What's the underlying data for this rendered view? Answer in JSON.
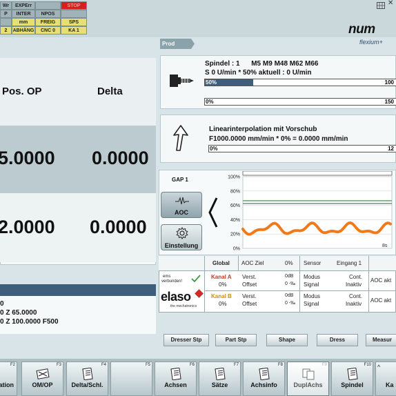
{
  "status_grid": {
    "r1": [
      "Wr",
      "EXPErr",
      "",
      "STOP"
    ],
    "r2": [
      "P",
      "INTER",
      "NPOS",
      ""
    ],
    "r3": [
      "",
      "mm",
      "FREIG",
      "SPS"
    ],
    "r4": [
      "2",
      "ABHÄNG",
      "CNC 0",
      "KA 1"
    ]
  },
  "brand": {
    "logo": "num",
    "subtitle": "flexium+",
    "window_icon": "window-grid-icon",
    "close_glyph": "✕"
  },
  "mode_tab": "Prod",
  "axis_table": {
    "col_pos": "Pos. OP",
    "col_delta": "Delta",
    "rows": [
      {
        "pos": "5.0000",
        "delta": "0.0000"
      },
      {
        "pos": "2.0000",
        "delta": "0.0000"
      }
    ]
  },
  "program": {
    "line1": "0",
    "line2": "0 Z 65.0000",
    "line3": "0 Z 100.0000 F500"
  },
  "spindle": {
    "line1": "Spindel : 1      M5 M9 M48 M62 M66",
    "line2": "S 0 U/min * 50% aktuell : 0 U/min",
    "bar1_label": "50%",
    "bar1_end": "100",
    "bar1_value": 50,
    "bar2_label": "0%",
    "bar2_end": "150",
    "bar2_value": 0
  },
  "interpolation": {
    "line1": "Linearinterpolation mit Vorschub",
    "line2": "F1000.0000 mm/min * 0% = 0.0000 mm/min",
    "bar_label": "0%",
    "bar_end": "12",
    "bar_value": 0
  },
  "gap": {
    "title": "GAP 1",
    "aoc_label": "AOC",
    "settings_label": "Einstellung",
    "y_ticks": [
      "100%",
      "80%",
      "60%",
      "40%",
      "20%",
      "0%"
    ],
    "time_label": "8s"
  },
  "aoc_table": {
    "headers": [
      "Global",
      "AOC Ziel",
      "0%",
      "Sensor",
      "Eingang 1"
    ],
    "status_text1": "ems",
    "status_text2": "verbunden!",
    "brand_name": "elaso",
    "brand_sub": "the mechatronics",
    "rowA": {
      "kanal": "Kanal A",
      "pct": "0%",
      "v1": "Verst.",
      "v2": "Offset",
      "db": "0dB",
      "mv": "0 -‰",
      "m1": "Modus",
      "m2": "Signal",
      "c1": "Cont.",
      "c2": "Inaktiv",
      "aoc": "AOC akt"
    },
    "rowB": {
      "kanal": "Kanal B",
      "pct": "0%",
      "v1": "Verst.",
      "v2": "Offset",
      "db": "0dB",
      "mv": "0 -‰",
      "m1": "Modus",
      "m2": "Signal",
      "c1": "Cont.",
      "c2": "Inaktiv",
      "aoc": "AOC akt"
    }
  },
  "softkeys": [
    "Dresser Stp",
    "Part Stp",
    "Shape",
    "Dress",
    "Measur"
  ],
  "fkeys": [
    {
      "num": "F2",
      "label": "ation"
    },
    {
      "num": "F3",
      "label": "OM/OP"
    },
    {
      "num": "F4",
      "label": "Delta/Schl."
    },
    {
      "num": "F5",
      "label": ""
    },
    {
      "num": "F6",
      "label": "Achsen"
    },
    {
      "num": "F7",
      "label": "Sätze"
    },
    {
      "num": "F8",
      "label": "Achsinfo"
    },
    {
      "num": "F9",
      "label": "DuplAchs"
    },
    {
      "num": "F10",
      "label": "Spindel"
    },
    {
      "num": "",
      "label": "Ka"
    }
  ],
  "colors": {
    "accent": "#3f5e7b",
    "stop": "#d32020",
    "signal": "#f07a1a",
    "green_line": "#5aa55a",
    "kanalA": "#c0392b",
    "kanalB": "#d08a12"
  }
}
